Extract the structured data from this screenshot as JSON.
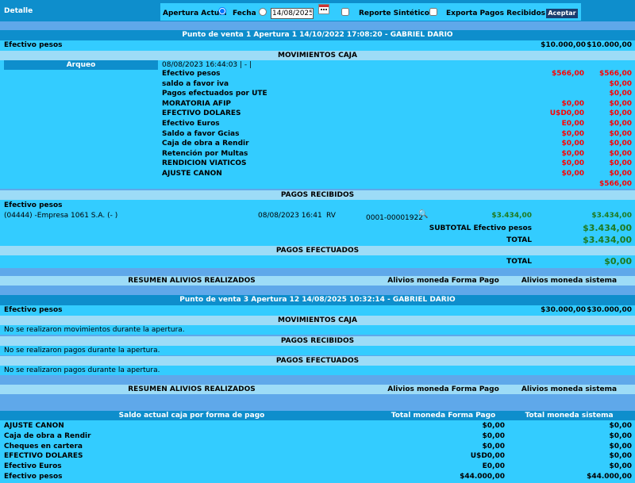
{
  "topbar": {
    "title": "Detalle",
    "apertura_actual": "Apertura Actual",
    "fecha": "Fecha",
    "date_value": "14/08/2025",
    "reporte": "Reporte Sintético",
    "exporta": "Exporta Pagos Recibidos",
    "aceptar": "Aceptar"
  },
  "pv1": {
    "title": "Punto de venta 1 Apertura 1 14/10/2022 17:08:20 - GABRIEL DARIO",
    "efectivo_label": "Efectivo pesos",
    "efectivo_v1": "$10.000,00",
    "efectivo_v2": "$10.000,00",
    "movimientos_title": "MOVIMIENTOS CAJA",
    "arqueo_label": "Arqueo",
    "arqueo_date": "08/08/2023 16:44:03 | - |",
    "movs": [
      {
        "label": "Efectivo pesos",
        "v1": "$566,00",
        "v2": "$566,00"
      },
      {
        "label": "saldo a favor iva",
        "v1": "",
        "v2": "$0,00"
      },
      {
        "label": "Pagos efectuados por UTE",
        "v1": "",
        "v2": "$0,00"
      },
      {
        "label": "MORATORIA AFIP",
        "v1": "$0,00",
        "v2": "$0,00"
      },
      {
        "label": "EFECTIVO DOLARES",
        "v1": "U$D0,00",
        "v2": "$0,00"
      },
      {
        "label": "Efectivo Euros",
        "v1": "E0,00",
        "v2": "$0,00"
      },
      {
        "label": "Saldo a favor Gcias",
        "v1": "$0,00",
        "v2": "$0,00"
      },
      {
        "label": "Caja de obra a Rendir",
        "v1": "$0,00",
        "v2": "$0,00"
      },
      {
        "label": "Retención por Multas",
        "v1": "$0,00",
        "v2": "$0,00"
      },
      {
        "label": "RENDICION VIATICOS",
        "v1": "$0,00",
        "v2": "$0,00"
      },
      {
        "label": "AJUSTE CANON",
        "v1": "$0,00",
        "v2": "$0,00"
      }
    ],
    "movs_total": "$566,00",
    "pagos_recibidos_title": "PAGOS RECIBIDOS",
    "pr_efectivo": "Efectivo pesos",
    "pr_cliente": "(04444) -Empresa 1061 S.A. (- )",
    "pr_fecha": "08/08/2023 16:41",
    "pr_tipo": "RV",
    "pr_comprobante": "0001-00001922",
    "pr_monto": "$3.434,00",
    "pr_monto2": "$3.434,00",
    "subtotal_label": "SUBTOTAL Efectivo pesos",
    "subtotal_value": "$3.434,00",
    "total_label": "TOTAL",
    "total_value": "$3.434,00",
    "pagos_efectuados_title": "PAGOS EFECTUADOS",
    "pe_total_label": "TOTAL",
    "pe_total_value": "$0,00",
    "resumen_title": "RESUMEN ALIVIOS REALIZADOS",
    "resumen_col2": "Alivios moneda Forma Pago",
    "resumen_col3": "Alivios moneda sistema"
  },
  "pv3": {
    "title": "Punto de venta 3 Apertura 12 14/08/2025 10:32:14 - GABRIEL DARIO",
    "efectivo_label": "Efectivo pesos",
    "efectivo_v1": "$30.000,00",
    "efectivo_v2": "$30.000,00",
    "movimientos_title": "MOVIMIENTOS CAJA",
    "no_movs": "No se realizaron movimientos durante la apertura.",
    "pagos_recibidos_title": "PAGOS RECIBIDOS",
    "no_pagos_rec": "No se realizaron pagos durante la apertura.",
    "pagos_efectuados_title": "PAGOS EFECTUADOS",
    "no_pagos_ef": "No se realizaron pagos durante la apertura.",
    "resumen_title": "RESUMEN ALIVIOS REALIZADOS",
    "resumen_col2": "Alivios moneda Forma Pago",
    "resumen_col3": "Alivios moneda sistema"
  },
  "saldo": {
    "col1": "Saldo actual caja por forma de pago",
    "col2": "Total moneda Forma Pago",
    "col3": "Total moneda sistema",
    "rows": [
      {
        "label": "AJUSTE CANON",
        "v1": "$0,00",
        "v2": "$0,00"
      },
      {
        "label": "Caja de obra a Rendir",
        "v1": "$0,00",
        "v2": "$0,00"
      },
      {
        "label": "Cheques en cartera",
        "v1": "$0,00",
        "v2": "$0,00"
      },
      {
        "label": "EFECTIVO DOLARES",
        "v1": "U$D0,00",
        "v2": "$0,00"
      },
      {
        "label": "Efectivo Euros",
        "v1": "E0,00",
        "v2": "$0,00"
      },
      {
        "label": "Efectivo pesos",
        "v1": "$44.000,00",
        "v2": "$44.000,00"
      }
    ]
  }
}
